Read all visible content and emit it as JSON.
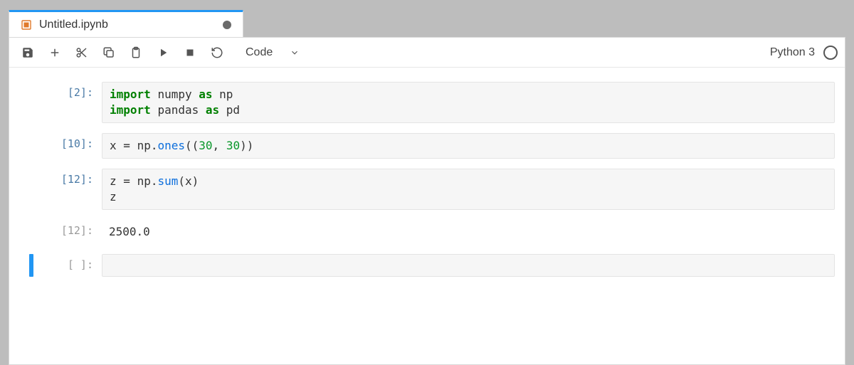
{
  "tab": {
    "title": "Untitled.ipynb",
    "dirty": true
  },
  "toolbar": {
    "celltype": "Code"
  },
  "kernel": {
    "name": "Python 3"
  },
  "cells": [
    {
      "kind": "code",
      "prompt": "[2]:",
      "executed": true,
      "code_html": "<span class=\"kw\">import</span> <span class=\"p\">numpy</span> <span class=\"kw\">as</span> <span class=\"p\">np</span>\n<span class=\"kw\">import</span> <span class=\"p\">pandas</span> <span class=\"kw\">as</span> <span class=\"p\">pd</span>",
      "source": "import numpy as np\nimport pandas as pd"
    },
    {
      "kind": "code",
      "prompt": "[10]:",
      "executed": true,
      "code_html": "<span class=\"p\">x</span> <span class=\"p\">=</span> <span class=\"p\">np</span><span class=\"p\">.</span><span class=\"fn\">ones</span><span class=\"p\">((</span><span class=\"num\">30</span><span class=\"p\">,</span> <span class=\"num\">30</span><span class=\"p\">))</span>",
      "source": "x = np.ones((30, 30))"
    },
    {
      "kind": "code",
      "prompt": "[12]:",
      "executed": true,
      "code_html": "<span class=\"p\">z</span> <span class=\"p\">=</span> <span class=\"p\">np</span><span class=\"p\">.</span><span class=\"fn\">sum</span><span class=\"p\">(x)</span>\n<span class=\"p\">z</span>",
      "source": "z = np.sum(x)\nz"
    },
    {
      "kind": "output",
      "prompt": "[12]:",
      "text": "2500.0"
    },
    {
      "kind": "code",
      "prompt": "[ ]:",
      "executed": false,
      "active": true,
      "code_html": "",
      "source": ""
    }
  ]
}
